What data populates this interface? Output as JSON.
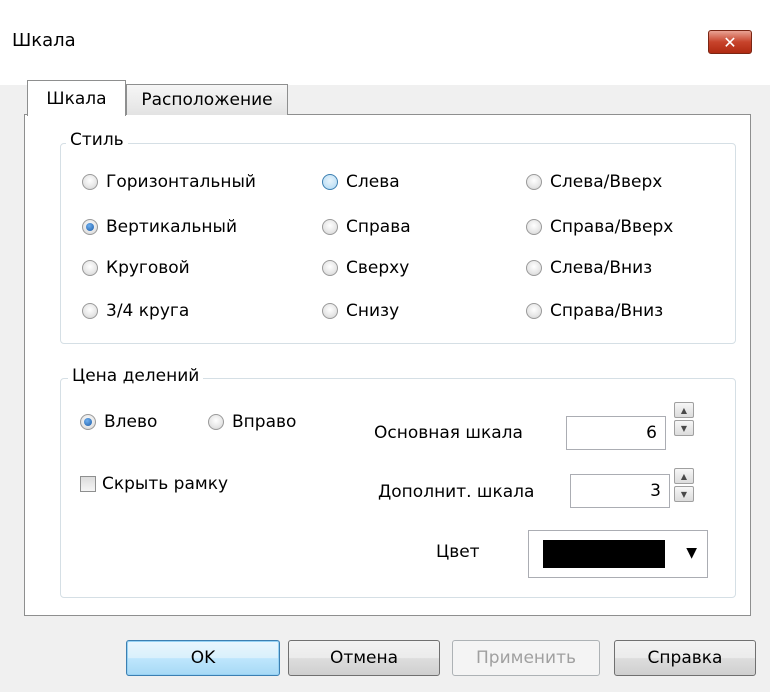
{
  "window": {
    "title": "Шкала",
    "close_glyph": "✕"
  },
  "tabs": [
    {
      "label": "Шкала",
      "active": true
    },
    {
      "label": "Расположение",
      "active": false
    }
  ],
  "style_group": {
    "legend": "Стиль",
    "options": [
      {
        "label": "Горизонтальный",
        "checked": false
      },
      {
        "label": "Слева",
        "checked": false
      },
      {
        "label": "Слева/Вверх",
        "checked": false
      },
      {
        "label": "Вертикальный",
        "checked": true
      },
      {
        "label": "Справа",
        "checked": false
      },
      {
        "label": "Справа/Вверх",
        "checked": false
      },
      {
        "label": "Круговой",
        "checked": false
      },
      {
        "label": "Сверху",
        "checked": false
      },
      {
        "label": "Слева/Вниз",
        "checked": false
      },
      {
        "label": "3/4 круга",
        "checked": false
      },
      {
        "label": "Снизу",
        "checked": false
      },
      {
        "label": "Справа/Вниз",
        "checked": false
      }
    ]
  },
  "divisions_group": {
    "legend": "Цена делений",
    "left_label": "Влево",
    "right_label": "Вправо",
    "hide_frame_label": "Скрыть рамку",
    "main_scale_label": "Основная шкала",
    "main_scale_value": "6",
    "extra_scale_label": "Дополнит. шкала",
    "extra_scale_value": "3",
    "color_label": "Цвет",
    "color_value": "#000000"
  },
  "buttons": {
    "ok": "OK",
    "cancel": "Отмена",
    "apply": "Применить",
    "help": "Справка"
  }
}
